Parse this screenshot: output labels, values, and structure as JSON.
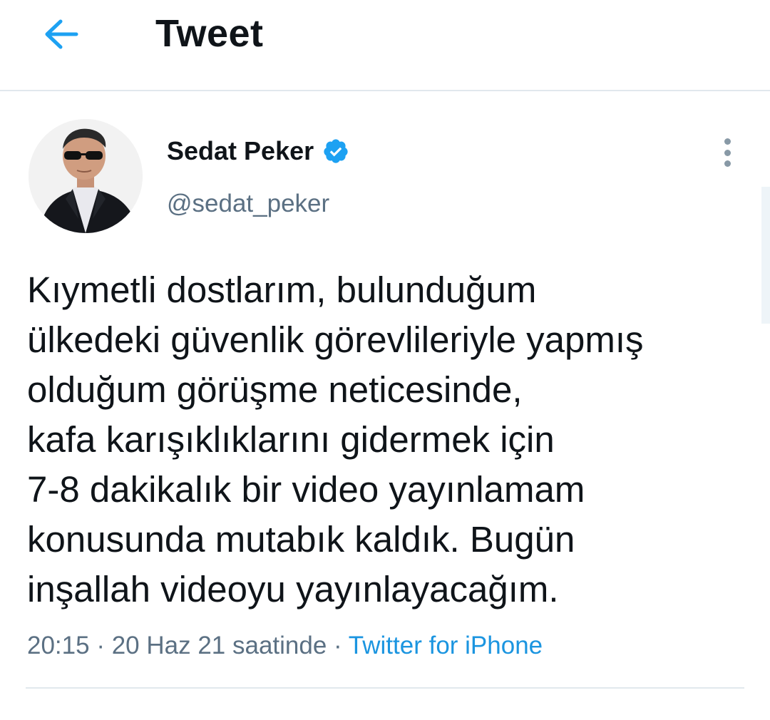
{
  "header": {
    "title": "Tweet",
    "back_icon": "arrow-left-icon",
    "accent_color": "#1da1f2"
  },
  "author": {
    "display_name": "Sedat Peker",
    "handle": "@sedat_peker",
    "verified_icon": "verified-badge-icon",
    "verified_color": "#1da1f2"
  },
  "tweet": {
    "text_lines": [
      "Kıymetli dostlarım, bulunduğum",
      "ülkedeki güvenlik görevlileriyle yapmış",
      "olduğum görüşme neticesinde,",
      "kafa karışıklıklarını gidermek için",
      "7-8 dakikalık bir video yayınlamam",
      "konusunda mutabık kaldık. Bugün",
      "inşallah videoyu yayınlayacağım."
    ],
    "time": "20:15",
    "separator": " · ",
    "date": "20 Haz 21 saatinde",
    "source": "Twitter for iPhone",
    "source_color": "#1b95e0"
  },
  "more_icon": "more-vertical-icon"
}
